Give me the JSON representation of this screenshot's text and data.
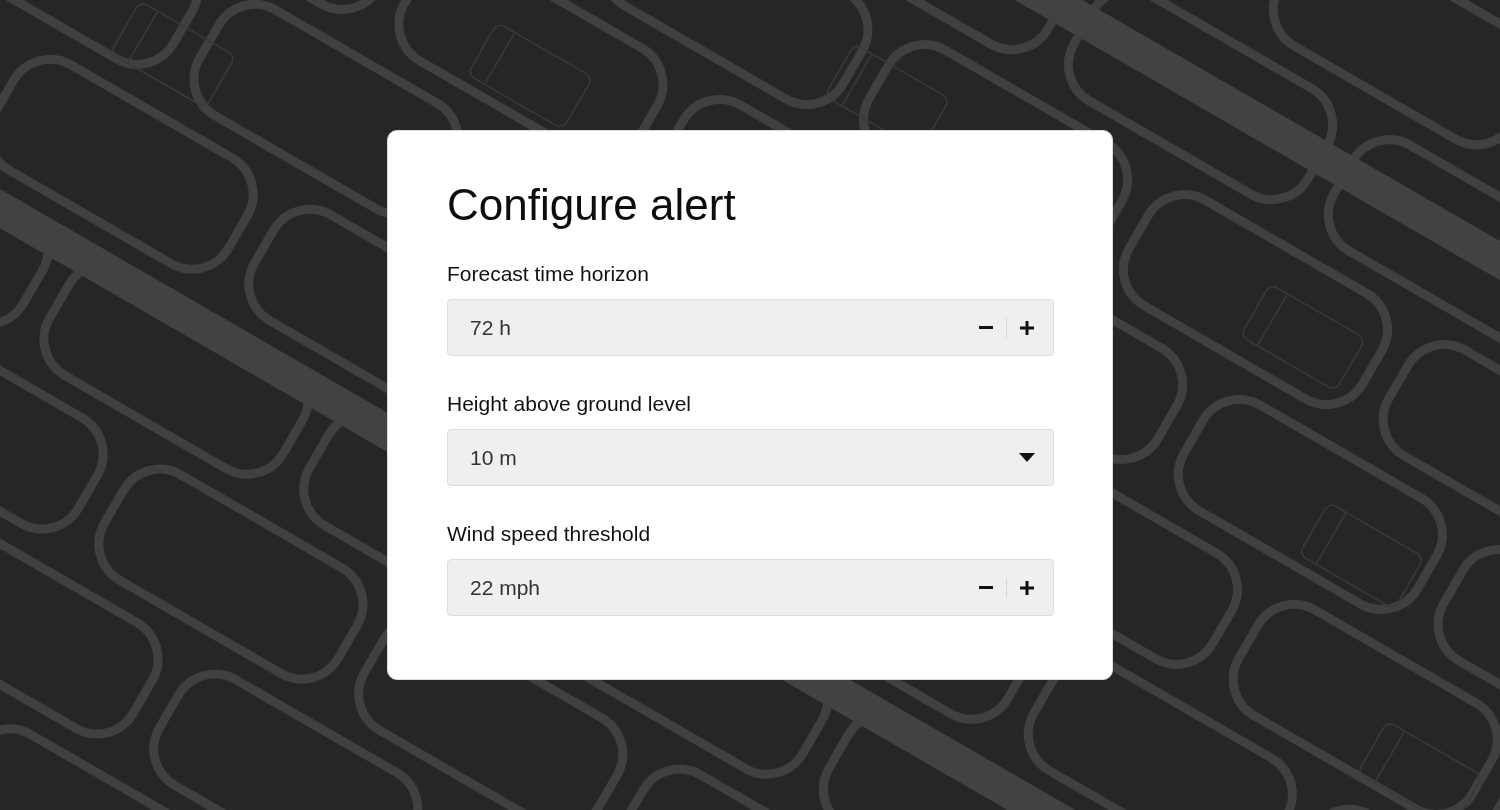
{
  "dialog": {
    "title": "Configure alert",
    "fields": [
      {
        "kind": "stepper",
        "label": "Forecast time horizon",
        "value": "72 h"
      },
      {
        "kind": "select",
        "label": "Height above ground level",
        "value": "10 m"
      },
      {
        "kind": "stepper",
        "label": "Wind speed threshold",
        "value": "22 mph"
      }
    ]
  }
}
